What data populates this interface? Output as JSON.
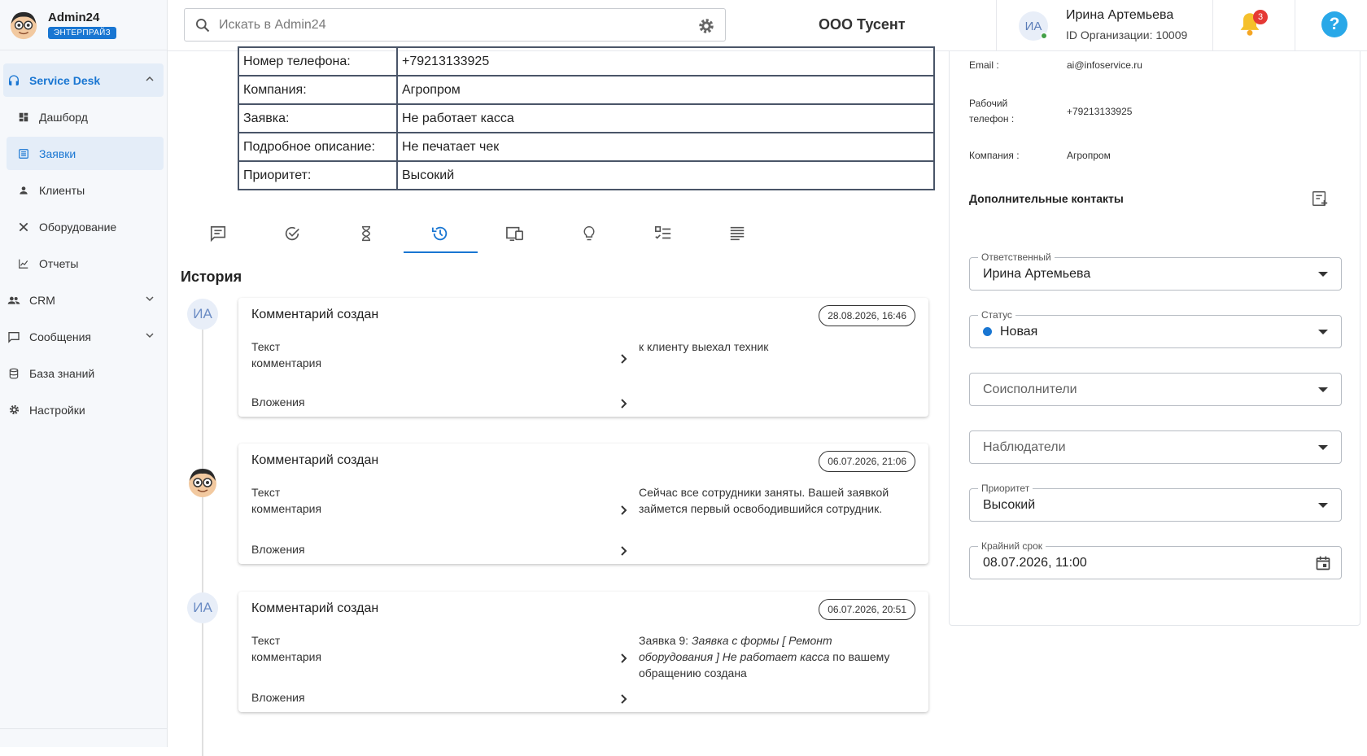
{
  "brand": {
    "name": "Admin24",
    "badge": "ЭНТЕРПРАЙЗ"
  },
  "sidebar": {
    "items": [
      {
        "label": "Service Desk",
        "icon": "headset-icon"
      },
      {
        "label": "Дашборд",
        "icon": "dashboard-icon"
      },
      {
        "label": "Заявки",
        "icon": "list-icon"
      },
      {
        "label": "Клиенты",
        "icon": "person-icon"
      },
      {
        "label": "Оборудование",
        "icon": "tools-icon"
      },
      {
        "label": "Отчеты",
        "icon": "chart-icon"
      },
      {
        "label": "CRM",
        "icon": "people-icon"
      },
      {
        "label": "Сообщения",
        "icon": "message-icon"
      },
      {
        "label": "База знаний",
        "icon": "database-icon"
      },
      {
        "label": "Настройки",
        "icon": "gear-icon"
      }
    ]
  },
  "header": {
    "search_placeholder": "Искать в Admin24",
    "org_name": "ООО Тусент",
    "user_initials": "ИА",
    "user_name": "Ирина Артемьева",
    "user_org": "ID Организации: 10009",
    "notifications": "3",
    "help": "?"
  },
  "ticket_table": [
    {
      "label": "Номер телефона:",
      "value": "+79213133925"
    },
    {
      "label": "Компания:",
      "value": "Агропром"
    },
    {
      "label": "Заявка:",
      "value": "Не работает касса"
    },
    {
      "label": "Подробное описание:",
      "value": "Не печатает чек"
    },
    {
      "label": "Приоритет:",
      "value": "Высокий"
    }
  ],
  "tabs": [
    "comments-icon",
    "check-circle-icon",
    "hourglass-icon",
    "history-icon",
    "devices-icon",
    "lightbulb-icon",
    "checklist-icon",
    "text-icon"
  ],
  "history": {
    "title": "История",
    "entries": [
      {
        "initials": "ИА",
        "title": "Комментарий создан",
        "date": "28.08.2026, 16:46",
        "text_label_1": "Текст",
        "text_label_2": "комментария",
        "attachments_label": "Вложения",
        "value_parts": [
          "к клиенту выехал техник"
        ]
      },
      {
        "initials": "",
        "title": "Комментарий создан",
        "date": "06.07.2026, 21:06",
        "text_label_1": "Текст",
        "text_label_2": "комментария",
        "attachments_label": "Вложения",
        "value_parts": [
          "Сейчас все сотрудники заняты. Вашей заявкой займется первый освободившийся сотрудник."
        ]
      },
      {
        "initials": "ИА",
        "title": "Комментарий создан",
        "date": "06.07.2026, 20:51",
        "text_label_1": "Текст",
        "text_label_2": "комментария",
        "attachments_label": "Вложения",
        "value_parts": [
          "Заявка 9: ",
          "Заявка с формы [ Ремонт оборудования ] Не работает касса",
          " по вашему обращению создана"
        ]
      }
    ]
  },
  "contact": {
    "email_label": "Email :",
    "email": "ai@infoservice.ru",
    "phone_label_1": "Рабочий",
    "phone_label_2": "телефон :",
    "phone": "+79213133925",
    "company_label": "Компания :",
    "company": "Агропром"
  },
  "extra_contacts_title": "Дополнительные контакты",
  "fields": {
    "responsible_label": "Ответственный",
    "responsible": "Ирина Артемьева",
    "status_label": "Статус",
    "status": "Новая",
    "coexecutors": "Соисполнители",
    "observers": "Наблюдатели",
    "priority_label": "Приоритет",
    "priority": "Высокий",
    "deadline_label": "Крайний срок",
    "deadline": "08.07.2026, 11:00"
  },
  "colors": {
    "accent": "#1976d2",
    "badge_red": "#e53935",
    "help_blue": "#29a8e8"
  }
}
